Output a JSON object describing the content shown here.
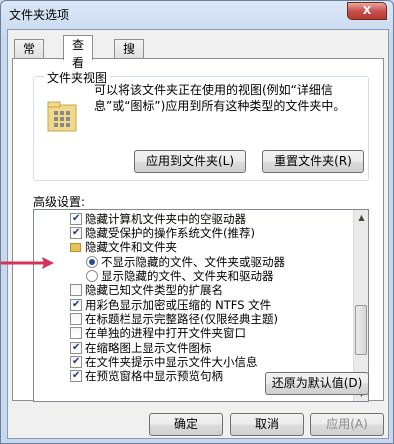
{
  "window": {
    "title": "文件夹选项",
    "close_glyph": "X"
  },
  "tabs": [
    {
      "label": "常规",
      "active": false
    },
    {
      "label": "查看",
      "active": true
    },
    {
      "label": "搜索",
      "active": false
    }
  ],
  "folder_views": {
    "title": "文件夹视图",
    "description": "可以将该文件夹正在使用的视图(例如“详细信息”或“图标”)应用到所有这种类型的文件夹中。",
    "apply_button": "应用到文件夹(L)",
    "reset_button": "重置文件夹(R)"
  },
  "advanced": {
    "label": "高级设置:",
    "items": [
      {
        "type": "checkbox",
        "checked": true,
        "label": "隐藏计算机文件夹中的空驱动器"
      },
      {
        "type": "checkbox",
        "checked": true,
        "label": "隐藏受保护的操作系统文件(推荐)"
      },
      {
        "type": "folder",
        "label": "隐藏文件和文件夹"
      },
      {
        "type": "radio",
        "checked": true,
        "label": "不显示隐藏的文件、文件夹或驱动器"
      },
      {
        "type": "radio",
        "checked": false,
        "label": "显示隐藏的文件、文件夹和驱动器"
      },
      {
        "type": "checkbox",
        "checked": false,
        "label": "隐藏已知文件类型的扩展名"
      },
      {
        "type": "checkbox",
        "checked": true,
        "label": "用彩色显示加密或压缩的 NTFS 文件"
      },
      {
        "type": "checkbox",
        "checked": false,
        "label": "在标题栏显示完整路径(仅限经典主题)"
      },
      {
        "type": "checkbox",
        "checked": false,
        "label": "在单独的进程中打开文件夹窗口"
      },
      {
        "type": "checkbox",
        "checked": true,
        "label": "在缩略图上显示文件图标"
      },
      {
        "type": "checkbox",
        "checked": true,
        "label": "在文件夹提示中显示文件大小信息"
      },
      {
        "type": "checkbox",
        "checked": true,
        "label": "在预览窗格中显示预览句柄"
      }
    ],
    "restore_button": "还原为默认值(D)"
  },
  "footer": {
    "ok": "确定",
    "cancel": "取消",
    "apply": "应用(A)"
  },
  "colors": {
    "highlight_arrow": "#d9325a",
    "window_frame": "#c6d7ee"
  }
}
